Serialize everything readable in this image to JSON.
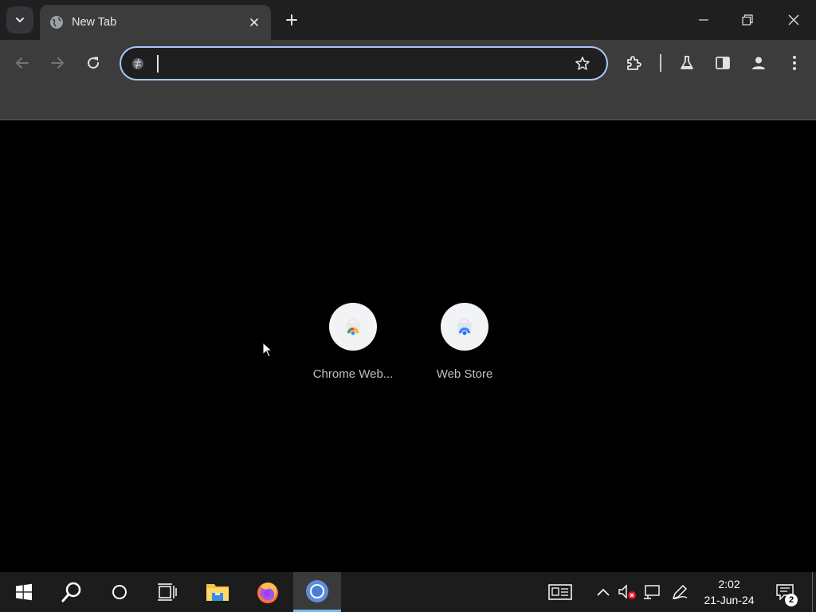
{
  "tabstrip": {
    "active_tab": {
      "title": "New Tab",
      "favicon": "globe-icon"
    },
    "controls": [
      "minimize-icon",
      "restore-icon",
      "close-icon"
    ]
  },
  "toolbar": {
    "omnibox": {
      "value": "",
      "placeholder": ""
    },
    "buttons": [
      "back-icon",
      "forward-icon",
      "reload-icon",
      "star-icon",
      "extensions-icon",
      "labs-icon",
      "side-panel-icon",
      "profile-icon",
      "menu-icon"
    ]
  },
  "shortcuts": [
    {
      "label": "Chrome Web...",
      "icon": "chrome-web-store-icon"
    },
    {
      "label": "Web Store",
      "icon": "web-store-icon"
    }
  ],
  "taskbar": {
    "apps": [
      "windows-start-icon",
      "search-icon",
      "cortana-icon",
      "task-view-icon",
      "file-explorer-icon",
      "firefox-icon",
      "chromium-icon"
    ],
    "active_app": "chromium-icon",
    "clock": {
      "time": "2:02",
      "date": "21-Jun-24"
    },
    "notification_count": "2"
  },
  "colors": {
    "accent": "#a8c7fa",
    "toolbar": "#3c3c3c",
    "tabstrip": "#1f1f1f",
    "taskbar": "#1c1c1c"
  }
}
